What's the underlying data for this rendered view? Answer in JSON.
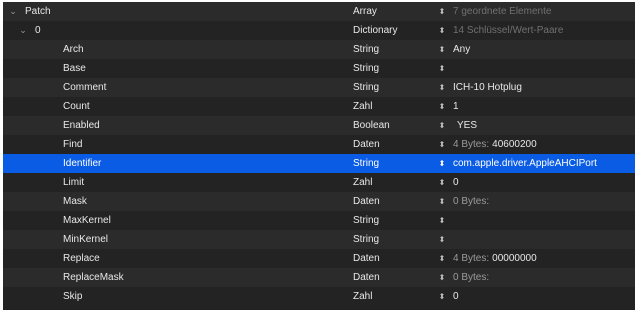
{
  "rows": [
    {
      "key": "Patch",
      "type": "Array",
      "value": "7 geordnete Elemente",
      "value_dim": true,
      "level": 0,
      "disclosure": "⌄"
    },
    {
      "key": "0",
      "type": "Dictionary",
      "value": "14 Schlüssel/Wert-Paare",
      "value_dim": true,
      "level": 1,
      "disclosure": "⌄"
    },
    {
      "key": "Arch",
      "type": "String",
      "value": "Any",
      "level": 2
    },
    {
      "key": "Base",
      "type": "String",
      "value": "",
      "level": 2
    },
    {
      "key": "Comment",
      "type": "String",
      "value": "ICH-10 Hotplug",
      "level": 2
    },
    {
      "key": "Count",
      "type": "Zahl",
      "value": "1",
      "level": 2
    },
    {
      "key": "Enabled",
      "type": "Boolean",
      "value": "YES",
      "level": 2
    },
    {
      "key": "Find",
      "type": "Daten",
      "bytes_label": "4 Bytes:",
      "bytes_hex": "40600200",
      "level": 2
    },
    {
      "key": "Identifier",
      "type": "String",
      "value": "com.apple.driver.AppleAHCIPort",
      "level": 2,
      "selected": true
    },
    {
      "key": "Limit",
      "type": "Zahl",
      "value": "0",
      "level": 2
    },
    {
      "key": "Mask",
      "type": "Daten",
      "bytes_label": "0 Bytes:",
      "bytes_hex": "",
      "level": 2
    },
    {
      "key": "MaxKernel",
      "type": "String",
      "value": "",
      "level": 2
    },
    {
      "key": "MinKernel",
      "type": "String",
      "value": "",
      "level": 2
    },
    {
      "key": "Replace",
      "type": "Daten",
      "bytes_label": "4 Bytes:",
      "bytes_hex": "00000000",
      "level": 2
    },
    {
      "key": "ReplaceMask",
      "type": "Daten",
      "bytes_label": "0 Bytes:",
      "bytes_hex": "",
      "level": 2
    },
    {
      "key": "Skip",
      "type": "Zahl",
      "value": "0",
      "level": 2
    }
  ],
  "icons": {
    "disclosure": "chevron-down-icon",
    "stepper": "up-down-stepper-icon"
  },
  "colors": {
    "selection": "#0b5ce5",
    "row_odd": "#2b2b2b",
    "row_even": "#232323"
  }
}
